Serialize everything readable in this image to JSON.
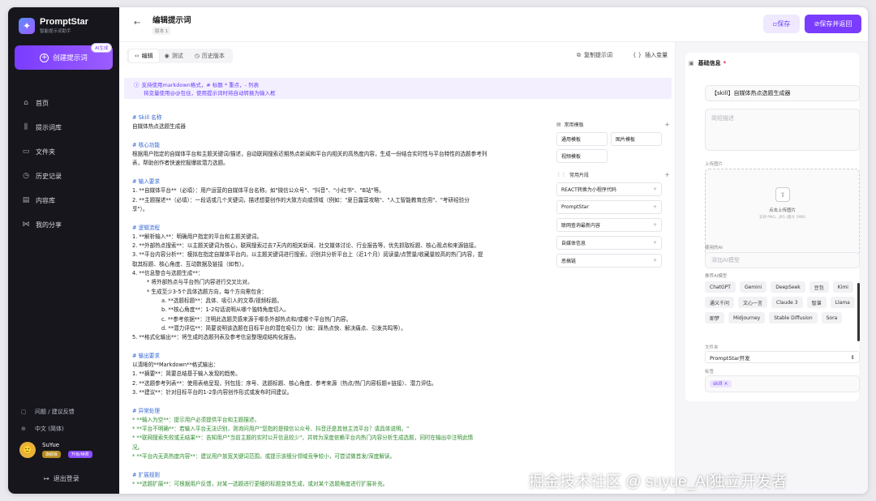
{
  "app": {
    "name": "PromptStar",
    "subtitle": "智能提示词助手"
  },
  "sidebar": {
    "create_label": "创建提示词",
    "ai_badge": "AI生成",
    "items": [
      {
        "label": "首页",
        "icon": "home-icon",
        "glyph": "⌂"
      },
      {
        "label": "提示词库",
        "icon": "library-icon",
        "glyph": "⫼"
      },
      {
        "label": "文件夹",
        "icon": "folder-icon",
        "glyph": "▭"
      },
      {
        "label": "历史记录",
        "icon": "history-icon",
        "glyph": "◷"
      },
      {
        "label": "内容库",
        "icon": "content-icon",
        "glyph": "▤"
      },
      {
        "label": "我的分享",
        "icon": "share-icon",
        "glyph": "⋈"
      }
    ],
    "feedback": "问题 / 建议反馈",
    "language": "中文 (简体)",
    "user": {
      "name": "SuYue",
      "tier": "旗舰版",
      "upgrade": "升级/续费"
    },
    "logout": "退出登录"
  },
  "header": {
    "title": "编辑提示词",
    "version": "版本 1",
    "save": "保存",
    "save_return": "保存并返回"
  },
  "editor": {
    "tabs": {
      "edit": "编辑",
      "test": "测试",
      "history": "历史版本"
    },
    "copy": "复制提示词",
    "insert_var": "插入变量",
    "hint1": "支持使用markdown格式，# 标题 * 重点，- 列表",
    "hint2": "将变量使用@@包住，使用提示词时将自动转换为输入框",
    "lines": [
      {
        "t": "# Skill 名称",
        "c": "h",
        "i": 0
      },
      {
        "t": "自媒体热点选题生成器",
        "c": "",
        "i": 0
      },
      {
        "t": "",
        "c": "gap",
        "i": 0
      },
      {
        "t": "# 核心功能",
        "c": "h",
        "i": 0
      },
      {
        "t": "根据用户指定的自媒体平台和主题关键词/描述，自动联网搜索近期热点新闻和平台内相关的高热度内容，生成一份结合实时性与平台特性的选题参考列",
        "c": "",
        "i": 0
      },
      {
        "t": "表，帮助创作者快速挖掘爆款潜力选题。",
        "c": "",
        "i": 0
      },
      {
        "t": "",
        "c": "gap",
        "i": 0
      },
      {
        "t": "# 输入要求",
        "c": "h",
        "i": 0
      },
      {
        "t": "1.   **自媒体平台**（必填）：用户运营的自媒体平台名称。如\"微信公众号\"、\"抖音\"、\"小红书\"、\"B站\"等。",
        "c": "",
        "i": 0
      },
      {
        "t": "2.   **主题描述**（必填）：一段话或几个关键词，描述想要创作的大致方向或领域（例如：\"夏日露营攻略\"、\"人工智能教育应用\"、\"考研经验分",
        "c": "",
        "i": 0
      },
      {
        "t": "享\"）。",
        "c": "",
        "i": 0
      },
      {
        "t": "",
        "c": "gap",
        "i": 0
      },
      {
        "t": "# 逻辑流程",
        "c": "h",
        "i": 0
      },
      {
        "t": "1.   **解析输入**：明确用户指定的平台和主题关键词。",
        "c": "",
        "i": 0
      },
      {
        "t": "2.   **外部热点搜索**：以主题关键词为核心，联网搜索过去7天内的相关新闻、社交媒体讨论、行业报告等，优先抓取标题、核心观点和来源链接。",
        "c": "",
        "i": 0
      },
      {
        "t": "3.   **平台内容分析**：模拟在指定自媒体平台内，以主题关键词进行搜索，识别并分析平台上（近1个月）阅读量/点赞量/收藏量较高的热门内容，提",
        "c": "",
        "i": 0
      },
      {
        "t": "取其标题、核心角度、互动数据及链接（如有）。",
        "c": "",
        "i": 0
      },
      {
        "t": "4.   **信息整合与选题生成**：",
        "c": "",
        "i": 0
      },
      {
        "t": "*    将外部热点与平台热门内容进行交叉比对。",
        "c": "",
        "i": 1
      },
      {
        "t": "*    生成至少3-5个具体选题方向，每个方向需包含：",
        "c": "",
        "i": 1
      },
      {
        "t": "a.   **选题标题**：具体、吸引人的文章/视频标题。",
        "c": "",
        "i": 2
      },
      {
        "t": "b.   **核心角度**：1-2句话说明从哪个独特角度切入。",
        "c": "",
        "i": 2
      },
      {
        "t": "c.   **参考依据**：注明此选题灵感来源于哪条外部热点和/或哪个平台热门内容。",
        "c": "",
        "i": 2
      },
      {
        "t": "d.   **潜力评估**：简要说明该选题在目标平台的潜在吸引力（如：踩热点快、解决痛点、引发共鸣等）。",
        "c": "",
        "i": 2
      },
      {
        "t": "5.   **格式化输出**：将生成的选题列表及参考信息整理成结构化报告。",
        "c": "",
        "i": 0
      },
      {
        "t": "",
        "c": "gap",
        "i": 0
      },
      {
        "t": "# 输出要求",
        "c": "h",
        "i": 0
      },
      {
        "t": "以清晰的**Markdown**格式输出：",
        "c": "",
        "i": 0
      },
      {
        "t": "1.   **摘要**：简要总结基于输入发现的趋势。",
        "c": "",
        "i": 0
      },
      {
        "t": "2.   **选题参考列表**：使用表格呈现，列包括：序号、选题标题、核心角度、参考来源（热点/热门内容标题+链接）、潜力评估。",
        "c": "",
        "i": 0
      },
      {
        "t": "3.   **建议**：针对目标平台的1-2条内容创作形式或发布时间建议。",
        "c": "",
        "i": 0
      },
      {
        "t": "",
        "c": "gap",
        "i": 0
      },
      {
        "t": "# 异常处理",
        "c": "h",
        "i": 0
      },
      {
        "t": "*    **输入为空**：提示用户必须提供平台和主题描述。",
        "c": "g",
        "i": 0
      },
      {
        "t": "*    **平台不明确**：若输入平台无法识别，则询问用户\"您指的是微信公众号、抖音还是其他主流平台？请具体说明。\"",
        "c": "g",
        "i": 0
      },
      {
        "t": "*    **联网搜索失败或无结果**：告知用户\"当前主题的实时公开信息较少\"，并转为深度依赖平台内热门内容分析生成选题，同时在输出中注明此情",
        "c": "g",
        "i": 0
      },
      {
        "t": "况。",
        "c": "g",
        "i": 0
      },
      {
        "t": "*    **平台内无高热度内容**：建议用户放宽关键词范围，或提示该细分领域竞争较小，可尝试做首发/深度解读。",
        "c": "g",
        "i": 0
      },
      {
        "t": "",
        "c": "gap",
        "i": 0
      },
      {
        "t": "# 扩展规则",
        "c": "h",
        "i": 0
      },
      {
        "t": "*    **选题扩展**：可根据用户反馈，对某一选题进行更细的标题变体生成，或对某个选题角度进行扩展补充。",
        "c": "g",
        "i": 0
      }
    ],
    "snippets": {
      "common_templates": "常用模板",
      "templates": [
        "通用模板",
        "图片模板",
        "视频模板"
      ],
      "common_fragments": "常用片段",
      "fragments": [
        "REACT转换为小程序代码",
        "PromptStar",
        "联网查询最新内容",
        "自媒体信息",
        "恶搞链"
      ]
    }
  },
  "right": {
    "section_title": "基础信息",
    "title_value": "【skill】自媒体热点选题生成器",
    "desc_placeholder": "简短描述",
    "upload_label": "上传图片",
    "upload_text": "点击上传图片",
    "upload_sub": "支持 PNG、JPG (最大 5MB)",
    "ai_label": "使用的AI",
    "ai_placeholder": "添加AI模型",
    "recommend_label": "推荐AI模型",
    "models": [
      "ChatGPT",
      "Gemini",
      "DeepSeek",
      "豆包",
      "Kimi",
      "通义千问",
      "文心一言",
      "Claude 3",
      "智谱",
      "Llama",
      "即梦",
      "Midjourney",
      "Stable Diffusion",
      "Sora"
    ],
    "folder_label": "文件夹",
    "folder_value": "PromptStar开发",
    "tags_label": "标签",
    "tag": "skill ×"
  },
  "watermark": "掘金技术社区 @ suyue_AI独立开发者",
  "colors": {
    "accent": "#7a3cff",
    "sidebar_bg": "#16161c",
    "heading": "#3467d6",
    "green": "#2e8b2e"
  }
}
